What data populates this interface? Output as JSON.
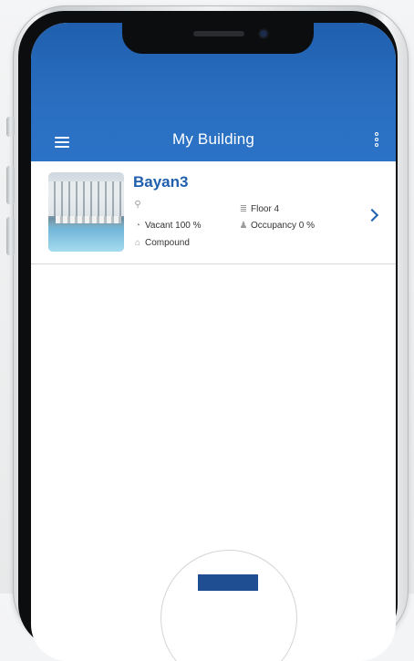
{
  "app": {
    "title": "My Building"
  },
  "building": {
    "name": "Bayan3",
    "floor": "Floor 4",
    "vacant": "Vacant 100 %",
    "occupancy": "Occupancy 0 %",
    "type": "Compound"
  },
  "icons": {
    "menu": "menu-icon",
    "more": "more-vertical-icon",
    "location": "location-pin-icon",
    "floor": "floor-layers-icon",
    "vacant": "pie-chart-icon",
    "occupancy": "person-icon",
    "type": "home-icon",
    "chevron": "chevron-right-icon"
  },
  "colors": {
    "brand": "#1f5fae",
    "background": "#ffffff"
  }
}
